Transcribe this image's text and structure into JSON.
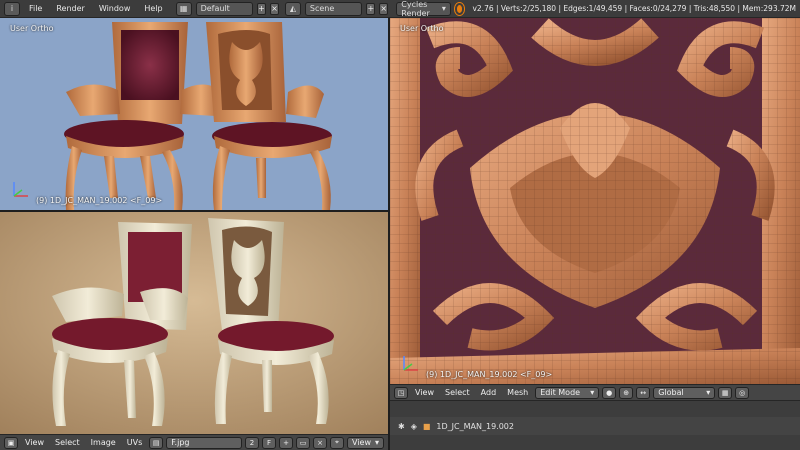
{
  "topbar": {
    "menus": [
      "File",
      "Render",
      "Window",
      "Help"
    ],
    "screen_layout": "Default",
    "scene": "Scene",
    "render_engine": "Cycles Render",
    "stats": "v2.76 | Verts:2/25,180 | Edges:1/49,459 | Faces:0/24,279 | Tris:48,550 | Mem:293.72M"
  },
  "viewport_top": {
    "view_label": "User Ortho",
    "object_label": "(9) 1D_JC_MAN_19.002 <F_09>"
  },
  "viewport_right": {
    "view_label": "User Ortho",
    "object_label": "(9) 1D_JC_MAN_19.002 <F_09>"
  },
  "view3d_header": {
    "menus": [
      "View",
      "Select",
      "Add",
      "Mesh"
    ],
    "mode": "Edit Mode",
    "orientation": "Global"
  },
  "image_header": {
    "menus": [
      "View",
      "Select",
      "Image",
      "UVs"
    ],
    "image_name": "F.jpg",
    "slot": "2",
    "slot_type": "F",
    "view_dropdown": "View"
  },
  "outliner": {
    "object_name": "1D_JC_MAN_19.002"
  },
  "colors": {
    "wood": "#d99a6a",
    "fabric_red": "#6e1d2c",
    "viewport_blue": "#8ba4c8",
    "render_bg": "#c3a57f"
  }
}
